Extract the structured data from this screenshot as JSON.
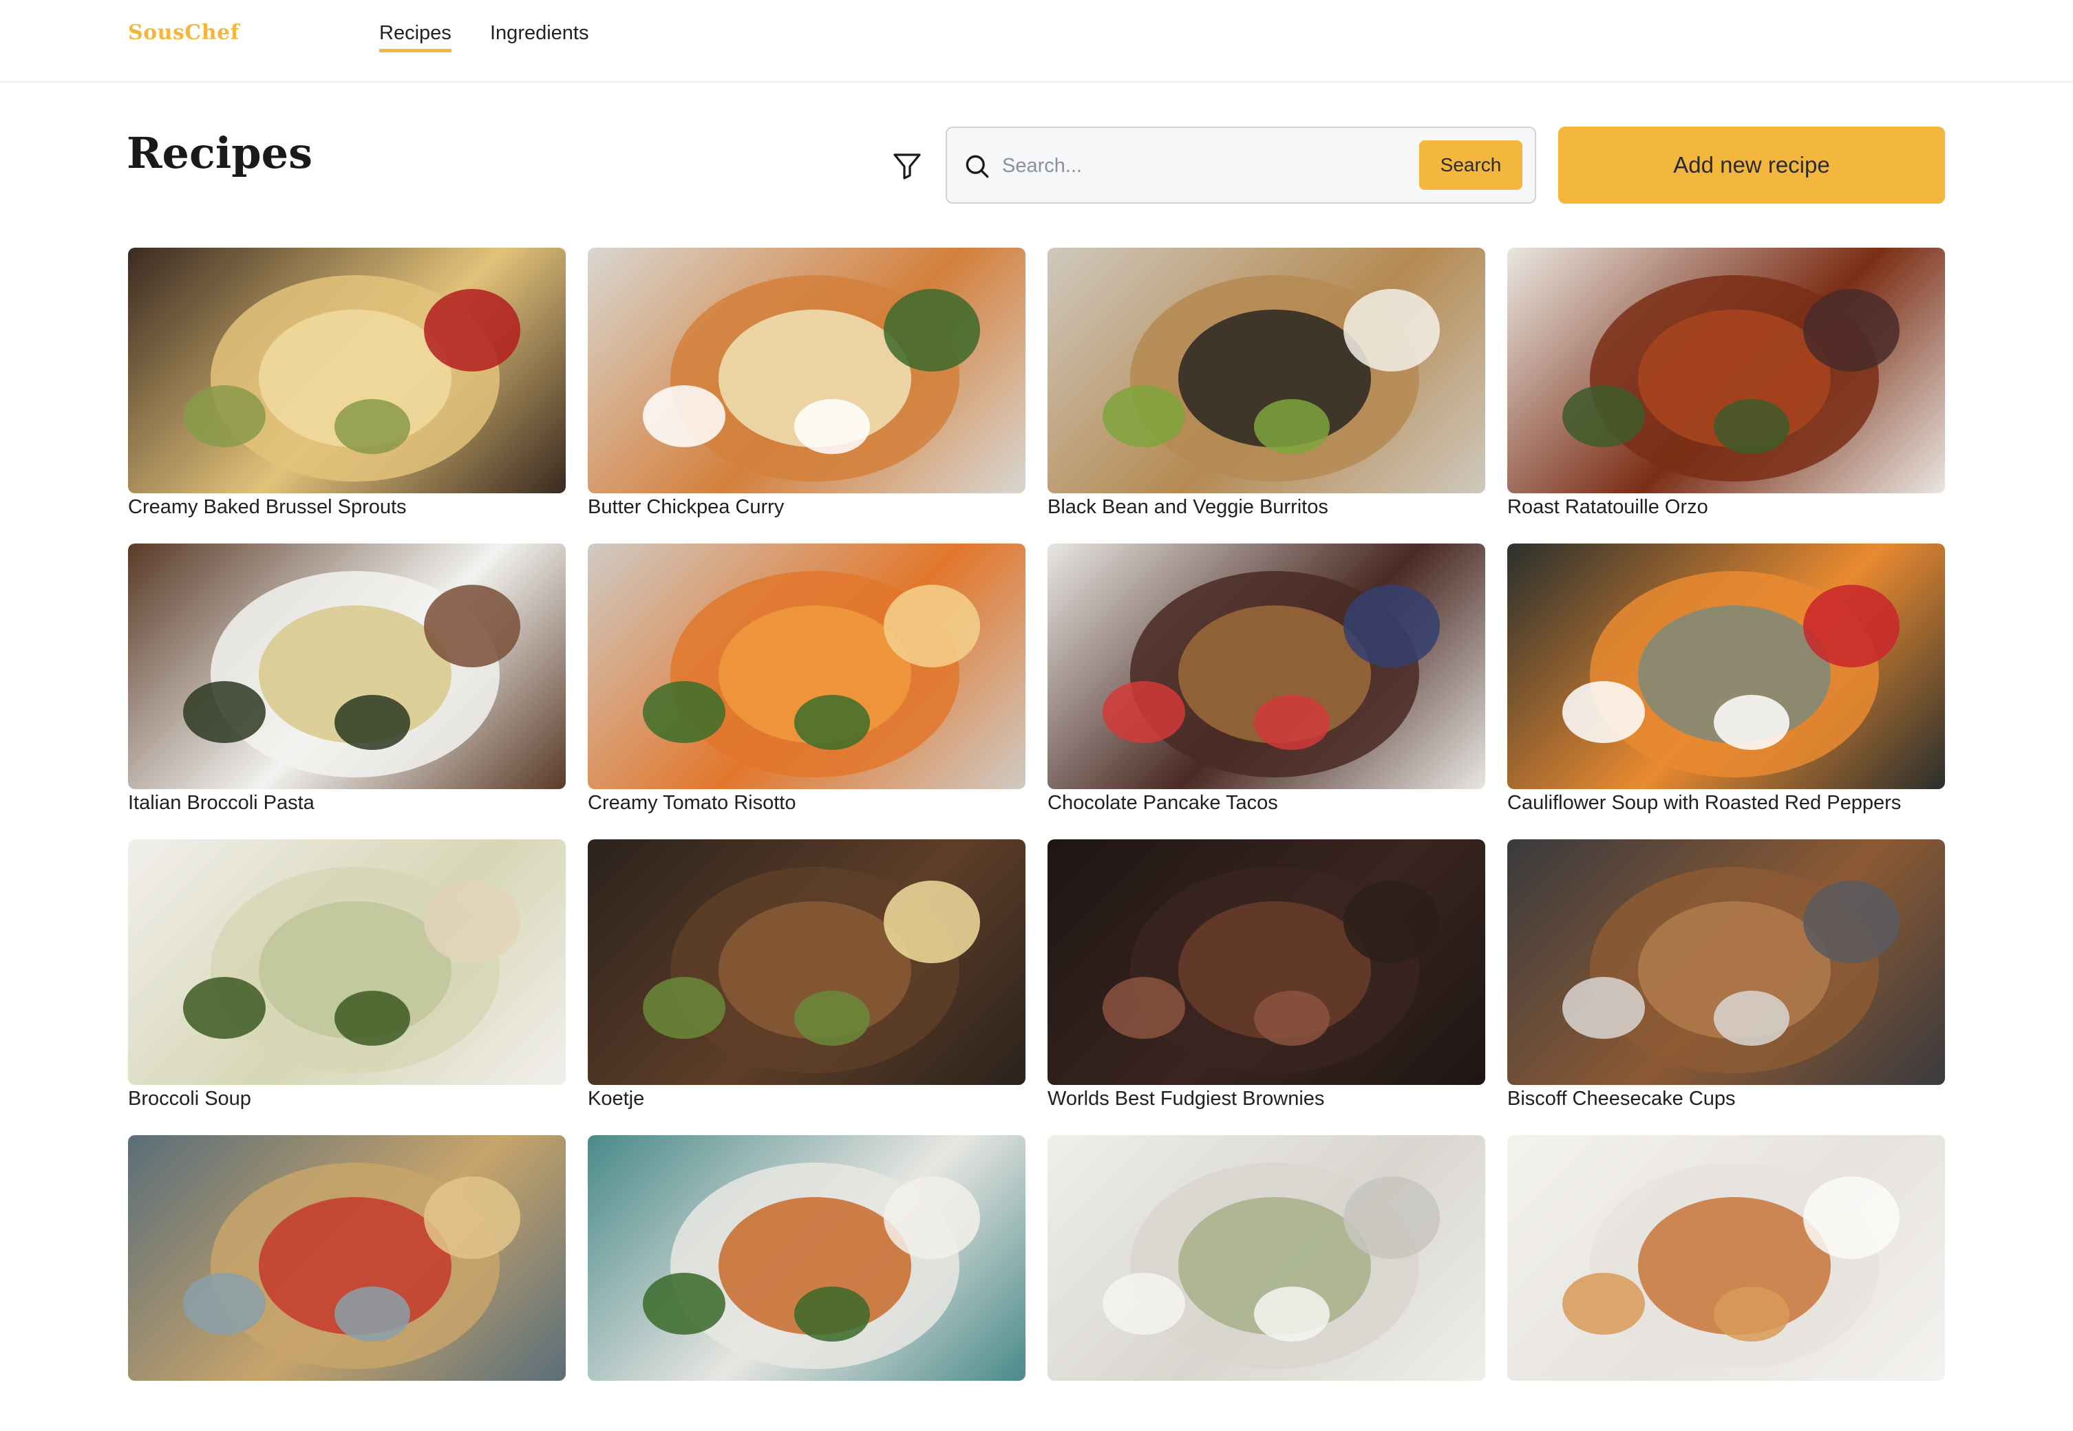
{
  "nav": {
    "brand": "SousChef",
    "links": [
      {
        "label": "Recipes",
        "active": true
      },
      {
        "label": "Ingredients",
        "active": false
      }
    ]
  },
  "header": {
    "title": "Recipes",
    "filter_icon": "filter-funnel-icon",
    "search": {
      "placeholder": "Search...",
      "value": "",
      "button_label": "Search"
    },
    "add_button_label": "Add new recipe"
  },
  "colors": {
    "accent": "#f2b73c",
    "search_bg": "#f6f7f9",
    "border": "#cfd3d8"
  },
  "recipes": [
    {
      "title": "Creamy Baked Brussel Sprouts",
      "palette": [
        "#3a2a20",
        "#e3c27a",
        "#f1dba0",
        "#8a9a4a",
        "#b21e1e"
      ]
    },
    {
      "title": "Butter Chickpea Curry",
      "palette": [
        "#d9d6d1",
        "#d4803c",
        "#f0e2b6",
        "#ffffff",
        "#3c6a2c"
      ]
    },
    {
      "title": "Black Bean and Veggie Burritos",
      "palette": [
        "#cfc8bd",
        "#b58a52",
        "#2b2622",
        "#7fa43c",
        "#f3efe6"
      ]
    },
    {
      "title": "Roast Ratatouille Orzo",
      "palette": [
        "#e9e6e1",
        "#7b2e16",
        "#a9441e",
        "#3e5c2a",
        "#4a2a2a"
      ]
    },
    {
      "title": "Italian Broccoli Pasta",
      "palette": [
        "#5a3a26",
        "#f2f2f0",
        "#d8c98a",
        "#2e3a22",
        "#7a5038"
      ]
    },
    {
      "title": "Creamy Tomato Risotto",
      "palette": [
        "#cfcac4",
        "#e2772c",
        "#f09a3e",
        "#3c6e2a",
        "#f4d08c"
      ]
    },
    {
      "title": "Chocolate Pancake Tacos",
      "palette": [
        "#e8e6e2",
        "#4a2a24",
        "#9c6a3a",
        "#d23a3a",
        "#34406e"
      ]
    },
    {
      "title": "Cauliflower Soup with Roasted Red Peppers",
      "palette": [
        "#2a2f2e",
        "#e98a30",
        "#7e8a7a",
        "#ffffff",
        "#c9262a"
      ]
    },
    {
      "title": "Broccoli Soup",
      "palette": [
        "#f1efec",
        "#d6d7b6",
        "#c0c59a",
        "#3e5a22",
        "#e2d3b8"
      ]
    },
    {
      "title": "Koetje",
      "palette": [
        "#2a221c",
        "#5e3e28",
        "#8a5a36",
        "#6a8a3a",
        "#f0dc9c"
      ]
    },
    {
      "title": "Worlds Best Fudgiest Brownies",
      "palette": [
        "#1e1614",
        "#3a2520",
        "#6a3c2c",
        "#8c5440",
        "#2c1e1a"
      ]
    },
    {
      "title": "Biscoff Cheesecake Cups",
      "palette": [
        "#3a3a3e",
        "#8c5a34",
        "#b07a4c",
        "#d9d6d2",
        "#5a5a60"
      ]
    },
    {
      "title": "",
      "palette": [
        "#5a6e7a",
        "#c8a46a",
        "#c43a2a",
        "#8aa0aa",
        "#e2c48a"
      ]
    },
    {
      "title": "",
      "palette": [
        "#4a8a8a",
        "#e8e6e2",
        "#c86a2a",
        "#3a6a2a",
        "#f2f0ea"
      ]
    },
    {
      "title": "",
      "palette": [
        "#f0eee9",
        "#d8d6cf",
        "#a6b08a",
        "#f5f4f0",
        "#c8c6bf"
      ]
    },
    {
      "title": "",
      "palette": [
        "#f4f2ef",
        "#e6e3de",
        "#c8763a",
        "#d89a58",
        "#fafaf8"
      ]
    }
  ]
}
